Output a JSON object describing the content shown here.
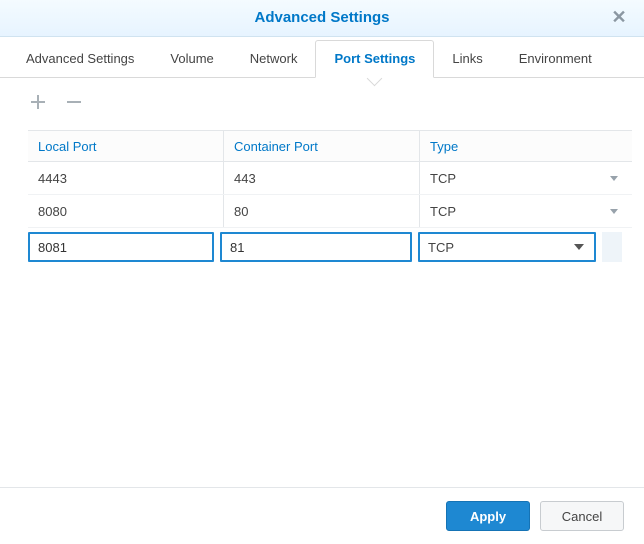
{
  "title": "Advanced Settings",
  "tabs": [
    {
      "label": "Advanced Settings",
      "active": false
    },
    {
      "label": "Volume",
      "active": false
    },
    {
      "label": "Network",
      "active": false
    },
    {
      "label": "Port Settings",
      "active": true
    },
    {
      "label": "Links",
      "active": false
    },
    {
      "label": "Environment",
      "active": false
    }
  ],
  "columns": {
    "local": "Local Port",
    "container": "Container Port",
    "type": "Type"
  },
  "rows": [
    {
      "local": "4443",
      "container": "443",
      "type": "TCP"
    },
    {
      "local": "8080",
      "container": "80",
      "type": "TCP"
    }
  ],
  "edit_row": {
    "local": "8081",
    "container": "81",
    "type": "TCP"
  },
  "buttons": {
    "apply": "Apply",
    "cancel": "Cancel"
  }
}
